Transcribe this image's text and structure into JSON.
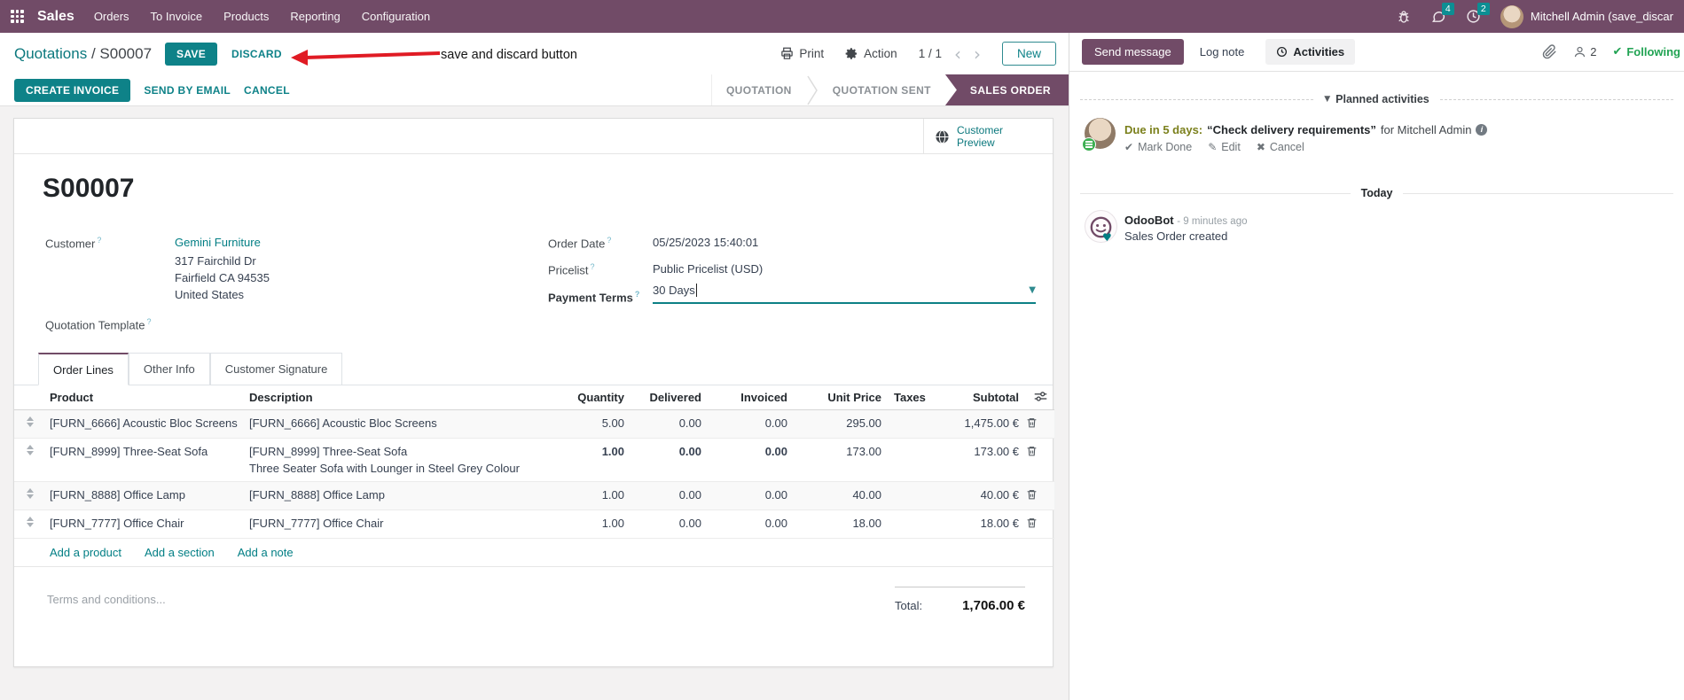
{
  "navbar": {
    "brand": "Sales",
    "items": [
      "Orders",
      "To Invoice",
      "Products",
      "Reporting",
      "Configuration"
    ],
    "messages_badge": "4",
    "activities_badge": "2",
    "user": "Mitchell Admin (save_discar"
  },
  "breadcrumb": {
    "parent": "Quotations",
    "current": "/ S00007"
  },
  "header_buttons": {
    "save": "SAVE",
    "discard": "DISCARD",
    "print": "Print",
    "action": "Action",
    "pager": "1 / 1",
    "prev": "‹",
    "next": "›",
    "new": "New"
  },
  "annotation": {
    "text": "save and discard button",
    "color": "#e01b24"
  },
  "action_buttons": {
    "create_invoice": "CREATE INVOICE",
    "send_by_email": "SEND BY EMAIL",
    "cancel": "CANCEL"
  },
  "statusbar": {
    "stages": [
      {
        "label": "QUOTATION",
        "active": false
      },
      {
        "label": "QUOTATION SENT",
        "active": false
      },
      {
        "label": "SALES ORDER",
        "active": true
      }
    ],
    "active_color": "#714B67"
  },
  "sheet": {
    "customer_preview": {
      "line1": "Customer",
      "line2": "Preview"
    },
    "title": "S00007",
    "fields": {
      "customer_label": "Customer",
      "customer_value": "Gemini Furniture",
      "address": [
        "317 Fairchild Dr",
        "Fairfield CA 94535",
        "United States"
      ],
      "quotation_template_label": "Quotation Template",
      "order_date_label": "Order Date",
      "order_date_value": "05/25/2023 15:40:01",
      "pricelist_label": "Pricelist",
      "pricelist_value": "Public Pricelist (USD)",
      "payment_terms_label": "Payment Terms",
      "payment_terms_value": "30 Days",
      "help_marker": "?"
    },
    "tabs": [
      {
        "label": "Order Lines"
      },
      {
        "label": "Other Info"
      },
      {
        "label": "Customer Signature"
      }
    ],
    "table": {
      "headers": {
        "product": "Product",
        "description": "Description",
        "quantity": "Quantity",
        "delivered": "Delivered",
        "invoiced": "Invoiced",
        "unit_price": "Unit Price",
        "taxes": "Taxes",
        "subtotal": "Subtotal"
      },
      "rows": [
        {
          "product": "[FURN_6666] Acoustic Bloc Screens",
          "description": "[FURN_6666] Acoustic Bloc Screens",
          "quantity": "5.00",
          "delivered": "0.00",
          "invoiced": "0.00",
          "unit_price": "295.00",
          "taxes": "",
          "subtotal": "1,475.00 €"
        },
        {
          "product": "[FURN_8999] Three-Seat Sofa",
          "description": "[FURN_8999] Three-Seat Sofa",
          "description2": "Three Seater Sofa with Lounger in Steel Grey Colour",
          "quantity": "1.00",
          "delivered": "0.00",
          "invoiced": "0.00",
          "unit_price": "173.00",
          "taxes": "",
          "subtotal": "173.00 €"
        },
        {
          "product": "[FURN_8888] Office Lamp",
          "description": "[FURN_8888] Office Lamp",
          "quantity": "1.00",
          "delivered": "0.00",
          "invoiced": "0.00",
          "unit_price": "40.00",
          "taxes": "",
          "subtotal": "40.00 €"
        },
        {
          "product": "[FURN_7777] Office Chair",
          "description": "[FURN_7777] Office Chair",
          "quantity": "1.00",
          "delivered": "0.00",
          "invoiced": "0.00",
          "unit_price": "18.00",
          "taxes": "",
          "subtotal": "18.00 €"
        }
      ],
      "footer_links": [
        "Add a product",
        "Add a section",
        "Add a note"
      ],
      "total_label": "Total:",
      "total_value": "1,706.00 €"
    },
    "terms_placeholder": "Terms and conditions..."
  },
  "chatter": {
    "send_message": "Send message",
    "log_note": "Log note",
    "activities": "Activities",
    "follower_count": "2",
    "following": "Following",
    "planned_header": "Planned activities",
    "activity": {
      "due": "Due in 5 days:",
      "title": "“Check delivery requirements”",
      "assignee": "for Mitchell Admin",
      "mark_done": "Mark Done",
      "edit": "Edit",
      "cancel": "Cancel"
    },
    "today": "Today",
    "message": {
      "author": "OdooBot",
      "time": "- 9 minutes ago",
      "body": "Sales Order created"
    }
  },
  "colors": {
    "brand_purple": "#714B67",
    "accent_teal": "#017e84",
    "button_teal": "#0e8288",
    "badge_teal": "#0c8e93",
    "following_green": "#21a353",
    "due_olive": "#7b801c",
    "annotation_red": "#e01b24"
  }
}
